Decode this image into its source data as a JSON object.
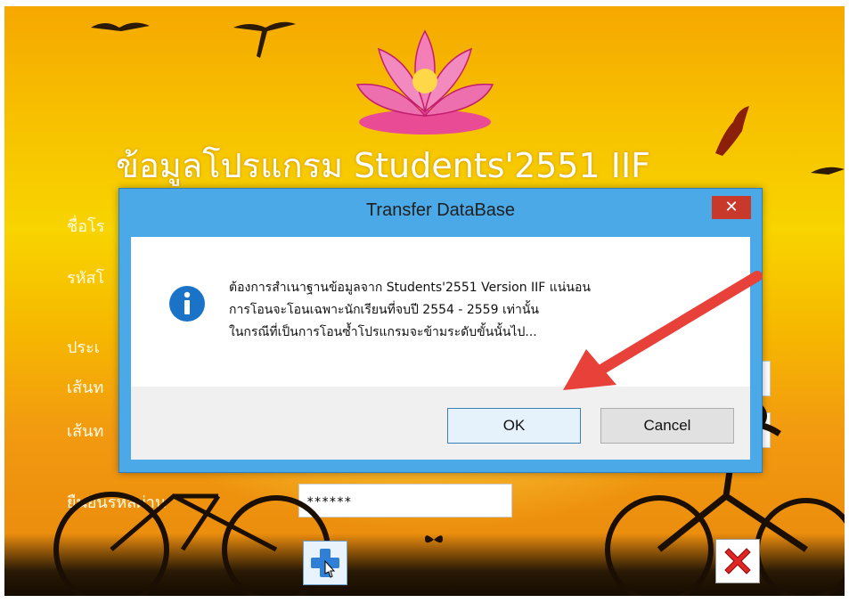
{
  "background": {
    "app_title": "ข้อมูลโปรแกรม Students'2551 IIF",
    "labels": [
      "ชื่อโร",
      "รหัสโ",
      "ประเ",
      "เส้นท",
      "เส้นท",
      "ยืนยันรหัสผ่าน"
    ],
    "password_value": "******"
  },
  "dialog": {
    "title": "Transfer DataBase",
    "close_glyph": "✕",
    "message_lines": [
      "ต้องการสำเนาฐานข้อมูลจาก Students'2551 Version IIF แน่นอน",
      "การโอนจะโอนเฉพาะนักเรียนที่จบปี 2554 - 2559 เท่านั้น",
      "ในกรณีที่เป็นการโอนซ้ำโปรแกรมจะข้ามระดับขั้นนั้นไป..."
    ],
    "ok_label": "OK",
    "cancel_label": "Cancel"
  },
  "colors": {
    "dialog_frame": "#4aa9e6",
    "close_button": "#c9392b",
    "annotation_arrow": "#e8413a",
    "info_icon": "#1a73c7"
  },
  "icons": [
    "lotus-logo-icon",
    "bird-icon",
    "info-icon",
    "close-icon",
    "add-user-icon",
    "exit-icon",
    "arrow-annotation-icon"
  ]
}
